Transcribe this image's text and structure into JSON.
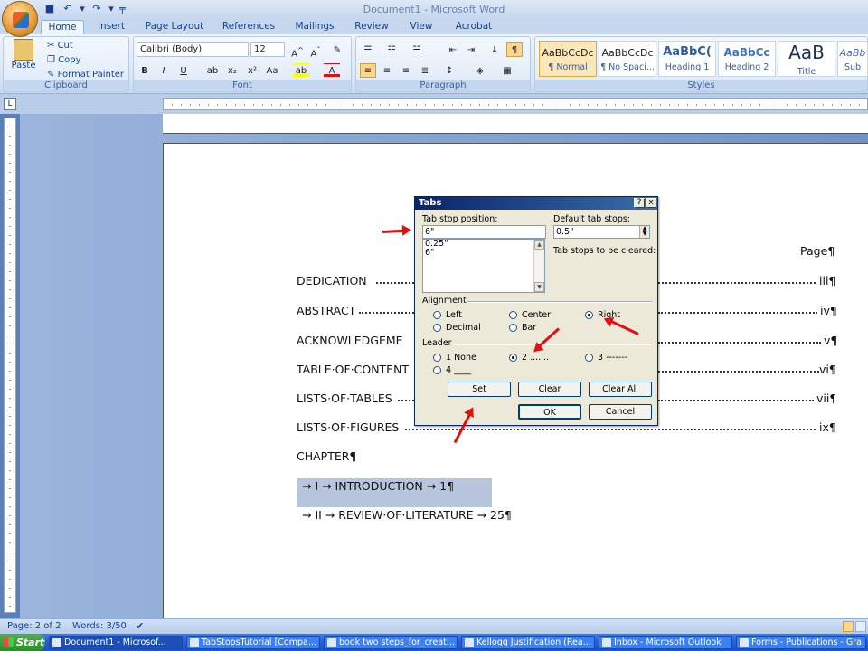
{
  "window": {
    "title": "Document1 - Microsoft Word"
  },
  "tabs": [
    "Home",
    "Insert",
    "Page Layout",
    "References",
    "Mailings",
    "Review",
    "View",
    "Acrobat"
  ],
  "clipboard": {
    "paste": "Paste",
    "cut": "Cut",
    "copy": "Copy",
    "format_painter": "Format Painter",
    "label": "Clipboard"
  },
  "font": {
    "name": "Calibri (Body)",
    "size": "12",
    "label": "Font"
  },
  "paragraph": {
    "label": "Paragraph"
  },
  "styles": {
    "label": "Styles",
    "items": [
      {
        "sample": "AaBbCcDc",
        "name": "¶ Normal"
      },
      {
        "sample": "AaBbCcDc",
        "name": "¶ No Spaci..."
      },
      {
        "sample": "AaBbC(",
        "name": "Heading 1"
      },
      {
        "sample": "AaBbCc",
        "name": "Heading 2"
      },
      {
        "sample": "AaB",
        "name": "Title"
      },
      {
        "sample": "AaBb",
        "name": "Sub"
      }
    ]
  },
  "document": {
    "page_header": "Page¶",
    "entries": [
      {
        "left": "DEDICATION",
        "right": "iii¶"
      },
      {
        "left": "ABSTRACT",
        "right": "iv¶"
      },
      {
        "left": "ACKNOWLEDGEME",
        "right": "v¶"
      },
      {
        "left": "TABLE·OF·CONTENT",
        "right": "vi¶"
      },
      {
        "left": "LISTS·OF·TABLES",
        "right": "vii¶"
      },
      {
        "left": "LISTS·OF·FIGURES",
        "right": "ix¶"
      }
    ],
    "chapter": "CHAPTER¶",
    "intro": "→  I → INTRODUCTION   →     1¶",
    "review": "→  II → REVIEW·OF·LITERATURE   →    25¶"
  },
  "dialog": {
    "title": "Tabs",
    "help": "?",
    "close": "x",
    "tab_stop_label": "Tab stop position:",
    "tab_stop_value": "6\"",
    "default_label": "Default tab stops:",
    "default_value": "0.5\"",
    "cleared_label": "Tab stops to be cleared:",
    "list_items": [
      "0.25\"",
      "6\""
    ],
    "alignment_label": "Alignment",
    "alignment": {
      "left": "Left",
      "center": "Center",
      "right": "Right",
      "decimal": "Decimal",
      "bar": "Bar",
      "selected": "Right"
    },
    "leader_label": "Leader",
    "leader": {
      "none": "1 None",
      "dots": "2 .......",
      "dashes": "3 -------",
      "line": "4 ____",
      "selected": "2"
    },
    "buttons": {
      "set": "Set",
      "clear": "Clear",
      "clear_all": "Clear All",
      "ok": "OK",
      "cancel": "Cancel"
    }
  },
  "status": {
    "page": "Page: 2 of 2",
    "words": "Words: 3/50"
  },
  "taskbar": {
    "start": "Start",
    "tasks": [
      "Document1 - Microsof...",
      "TabStopsTutorial [Compa...",
      "book two steps_for_creat...",
      "Kellogg Justification (Rea...",
      "Inbox - Microsoft Outlook",
      "Forms - Publications - Gra..."
    ]
  },
  "colors": {
    "accent": "#15428b",
    "annotation_arrow": "#e01010",
    "selection": "#b7c5dd"
  }
}
